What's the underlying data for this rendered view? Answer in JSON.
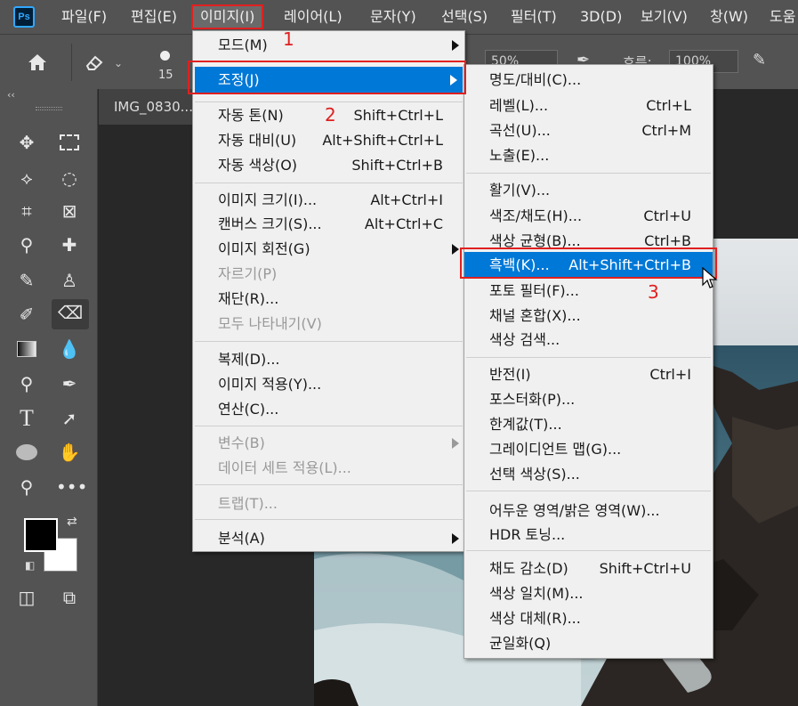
{
  "app": {
    "logo": "Ps"
  },
  "menubar": [
    {
      "label": "파일(F)"
    },
    {
      "label": "편집(E)"
    },
    {
      "label": "이미지(I)"
    },
    {
      "label": "레이어(L)"
    },
    {
      "label": "문자(Y)"
    },
    {
      "label": "선택(S)"
    },
    {
      "label": "필터(T)"
    },
    {
      "label": "3D(D)"
    },
    {
      "label": "보기(V)"
    },
    {
      "label": "창(W)"
    },
    {
      "label": "도움"
    }
  ],
  "options": {
    "brush_size": "15",
    "opacity_value": "50%",
    "flow_label": "흐름:",
    "flow_value": "100%"
  },
  "document": {
    "tab_label": "IMG_0830..."
  },
  "image_menu": {
    "items": [
      {
        "label": "모드(M)",
        "shortcut": "",
        "submenu": true,
        "disabled": false
      },
      {
        "label": "조정(J)",
        "shortcut": "",
        "submenu": true,
        "disabled": false,
        "highlighted": true
      },
      {
        "label": "자동 톤(N)",
        "shortcut": "Shift+Ctrl+L"
      },
      {
        "label": "자동 대비(U)",
        "shortcut": "Alt+Shift+Ctrl+L"
      },
      {
        "label": "자동 색상(O)",
        "shortcut": "Shift+Ctrl+B"
      },
      {
        "label": "이미지 크기(I)...",
        "shortcut": "Alt+Ctrl+I"
      },
      {
        "label": "캔버스 크기(S)...",
        "shortcut": "Alt+Ctrl+C"
      },
      {
        "label": "이미지 회전(G)",
        "shortcut": "",
        "submenu": true
      },
      {
        "label": "자르기(P)",
        "shortcut": "",
        "disabled": true
      },
      {
        "label": "재단(R)...",
        "shortcut": ""
      },
      {
        "label": "모두 나타내기(V)",
        "shortcut": "",
        "disabled": true
      },
      {
        "label": "복제(D)...",
        "shortcut": ""
      },
      {
        "label": "이미지 적용(Y)...",
        "shortcut": ""
      },
      {
        "label": "연산(C)...",
        "shortcut": ""
      },
      {
        "label": "변수(B)",
        "shortcut": "",
        "submenu": true,
        "disabled": true
      },
      {
        "label": "데이터 세트 적용(L)...",
        "shortcut": "",
        "disabled": true
      },
      {
        "label": "트랩(T)...",
        "shortcut": "",
        "disabled": true
      },
      {
        "label": "분석(A)",
        "shortcut": "",
        "submenu": true
      }
    ]
  },
  "adjust_menu": {
    "items": [
      {
        "label": "명도/대비(C)...",
        "shortcut": ""
      },
      {
        "label": "레벨(L)...",
        "shortcut": "Ctrl+L"
      },
      {
        "label": "곡선(U)...",
        "shortcut": "Ctrl+M"
      },
      {
        "label": "노출(E)...",
        "shortcut": ""
      },
      {
        "label": "활기(V)...",
        "shortcut": ""
      },
      {
        "label": "색조/채도(H)...",
        "shortcut": "Ctrl+U"
      },
      {
        "label": "색상 균형(B)...",
        "shortcut": "Ctrl+B"
      },
      {
        "label": "흑백(K)...",
        "shortcut": "Alt+Shift+Ctrl+B",
        "highlighted": true
      },
      {
        "label": "포토 필터(F)...",
        "shortcut": ""
      },
      {
        "label": "채널 혼합(X)...",
        "shortcut": ""
      },
      {
        "label": "색상 검색...",
        "shortcut": ""
      },
      {
        "label": "반전(I)",
        "shortcut": "Ctrl+I"
      },
      {
        "label": "포스터화(P)...",
        "shortcut": ""
      },
      {
        "label": "한계값(T)...",
        "shortcut": ""
      },
      {
        "label": "그레이디언트 맵(G)...",
        "shortcut": ""
      },
      {
        "label": "선택 색상(S)...",
        "shortcut": ""
      },
      {
        "label": "어두운 영역/밝은 영역(W)...",
        "shortcut": ""
      },
      {
        "label": "HDR 토닝...",
        "shortcut": ""
      },
      {
        "label": "채도 감소(D)",
        "shortcut": "Shift+Ctrl+U"
      },
      {
        "label": "색상 일치(M)...",
        "shortcut": ""
      },
      {
        "label": "색상 대체(R)...",
        "shortcut": ""
      },
      {
        "label": "균일화(Q)",
        "shortcut": ""
      }
    ]
  },
  "annotations": {
    "step1": "1",
    "step2": "2",
    "step3": "3"
  },
  "colors": {
    "highlight": "#0078d7",
    "annotation": "#e02020",
    "menubar": "#535353"
  },
  "icons": [
    "home-icon",
    "eraser-icon",
    "move-icon",
    "marquee-icon",
    "lasso-icon",
    "quick-select-icon",
    "crop-icon",
    "frame-icon",
    "eyedropper-icon",
    "healing-icon",
    "brush-icon",
    "stamp-icon",
    "history-brush-icon",
    "eraser-tool-icon",
    "gradient-icon",
    "blur-icon",
    "dodge-icon",
    "pen-icon",
    "type-icon",
    "path-select-icon",
    "ellipse-icon",
    "hand-icon",
    "zoom-icon",
    "more-icon",
    "cursor-icon"
  ]
}
